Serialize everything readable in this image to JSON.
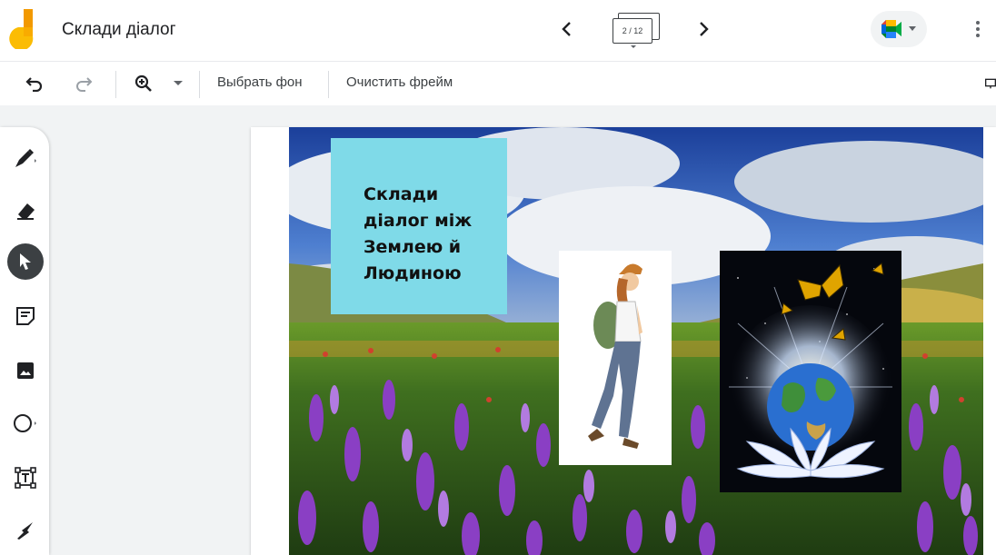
{
  "app": {
    "title": "Склади діалог",
    "logo_icon": "jamboard-logo"
  },
  "frames": {
    "counter": "2 / 12"
  },
  "toolbar": {
    "set_background": "Выбрать фон",
    "clear_frame": "Очистить фрейм"
  },
  "slide": {
    "note_text": "Склади діалог між Землею й Людиною",
    "note_color": "#7fdae8"
  },
  "tools": [
    "pen-icon",
    "eraser-icon",
    "select-icon",
    "sticky-note-icon",
    "image-icon",
    "circle-icon",
    "text-box-icon",
    "laser-icon"
  ],
  "colors": {
    "accent_dark": "#3c4043",
    "logo_orange": "#f9ab00",
    "logo_yellow": "#fbbc04"
  }
}
